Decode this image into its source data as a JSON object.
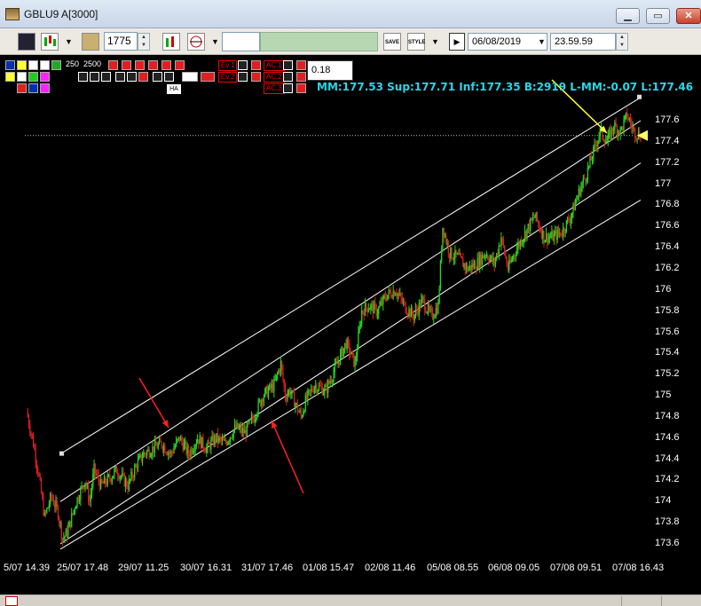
{
  "window": {
    "title": "GBLU9 A[3000]",
    "minimize_label": "▁",
    "restore_label": "▭",
    "close_label": "✕"
  },
  "toolbar": {
    "bars_value": "1775",
    "date_value": "06/08/2019",
    "time_value": "23.59.59",
    "save_tool_label": "SAVE",
    "style_tool_label": "STYLE"
  },
  "indicator_panel": {
    "row1_values": [
      "250",
      "2500"
    ],
    "ha_label": "HA",
    "param_value": "0.18",
    "buttons": [
      "Ev.1",
      "Ev.2",
      "AC.1",
      "AC.2",
      "AC.3"
    ]
  },
  "stats": {
    "text": "MM:177.53 Sup:177.71 Inf:177.35 B:2919 L-MM:-0.07 L:177.46"
  },
  "chart_data": {
    "type": "candlestick",
    "symbol": "GBLU9",
    "ylim": [
      173.45,
      177.95
    ],
    "y_ticks": [
      "177.6",
      "177.4",
      "177.2",
      "177",
      "176.8",
      "176.6",
      "176.4",
      "176.2",
      "176",
      "175.8",
      "175.6",
      "175.4",
      "175.2",
      "175",
      "174.8",
      "174.6",
      "174.4",
      "174.2",
      "174",
      "173.8",
      "173.6"
    ],
    "x_ticks": [
      "5/07 14.39",
      "25/07 17.48",
      "29/07 11.25",
      "30/07 16.31",
      "31/07 17.46",
      "01/08 15.47",
      "02/08 11.46",
      "05/08 08.55",
      "06/08 09.05",
      "07/08 09.51",
      "07/08 16.43"
    ],
    "price_path": [
      [
        0,
        174.85
      ],
      [
        3,
        174.55
      ],
      [
        5,
        174.3
      ],
      [
        8,
        173.85
      ],
      [
        11,
        174.05
      ],
      [
        14,
        173.9
      ],
      [
        16,
        173.65
      ],
      [
        18,
        173.7
      ],
      [
        22,
        174.0
      ],
      [
        26,
        174.2
      ],
      [
        28,
        174.0
      ],
      [
        30,
        174.3
      ],
      [
        33,
        174.15
      ],
      [
        36,
        174.2
      ],
      [
        40,
        174.3
      ],
      [
        45,
        174.15
      ],
      [
        49,
        174.35
      ],
      [
        52,
        174.45
      ],
      [
        56,
        174.5
      ],
      [
        60,
        174.55
      ],
      [
        64,
        174.45
      ],
      [
        68,
        174.6
      ],
      [
        72,
        174.45
      ],
      [
        76,
        174.6
      ],
      [
        80,
        174.5
      ],
      [
        84,
        174.6
      ],
      [
        88,
        174.55
      ],
      [
        93,
        174.7
      ],
      [
        97,
        174.65
      ],
      [
        101,
        174.8
      ],
      [
        105,
        175.0
      ],
      [
        110,
        175.1
      ],
      [
        113,
        175.3
      ],
      [
        115,
        175.0
      ],
      [
        117,
        175.05
      ],
      [
        120,
        174.9
      ],
      [
        122,
        174.8
      ],
      [
        124,
        174.95
      ],
      [
        128,
        175.1
      ],
      [
        133,
        175.05
      ],
      [
        138,
        175.3
      ],
      [
        142,
        175.5
      ],
      [
        146,
        175.3
      ],
      [
        149,
        175.8
      ],
      [
        152,
        175.85
      ],
      [
        156,
        175.8
      ],
      [
        160,
        175.95
      ],
      [
        164,
        176.0
      ],
      [
        168,
        175.85
      ],
      [
        172,
        175.75
      ],
      [
        176,
        175.9
      ],
      [
        180,
        175.75
      ],
      [
        183,
        175.85
      ],
      [
        185,
        176.6
      ],
      [
        188,
        176.35
      ],
      [
        192,
        176.3
      ],
      [
        196,
        176.2
      ],
      [
        200,
        176.25
      ],
      [
        204,
        176.35
      ],
      [
        208,
        176.25
      ],
      [
        211,
        176.5
      ],
      [
        214,
        176.2
      ],
      [
        218,
        176.4
      ],
      [
        222,
        176.55
      ],
      [
        226,
        176.7
      ],
      [
        230,
        176.5
      ],
      [
        234,
        176.5
      ],
      [
        238,
        176.55
      ],
      [
        242,
        176.7
      ],
      [
        246,
        176.95
      ],
      [
        249,
        177.1
      ],
      [
        252,
        177.3
      ],
      [
        255,
        177.5
      ],
      [
        258,
        177.4
      ],
      [
        261,
        177.55
      ],
      [
        264,
        177.5
      ],
      [
        267,
        177.65
      ],
      [
        270,
        177.5
      ],
      [
        273,
        177.46
      ]
    ],
    "channel_lines": [
      {
        "name": "upper",
        "from": [
          0,
          174.45
        ],
        "to": [
          100,
          177.82
        ]
      },
      {
        "name": "mid",
        "from": [
          0,
          174.0
        ],
        "to": [
          100,
          177.6
        ]
      },
      {
        "name": "lower_mid",
        "from": [
          0,
          173.6
        ],
        "to": [
          100,
          177.2
        ]
      },
      {
        "name": "lower",
        "from": [
          0,
          173.55
        ],
        "to": [
          100,
          176.85
        ]
      }
    ],
    "reference_level": 177.46,
    "up_color": "#22dd22",
    "down_color": "#e02020",
    "annotation_arrows": [
      {
        "color": "#ff2020",
        "target": "upper channel touch ~29/07"
      },
      {
        "color": "#ff2020",
        "target": "lower channel touch ~31/07"
      },
      {
        "color": "#ffff33",
        "target": "upper channel touch 07/08"
      }
    ]
  },
  "colors": {
    "background": "#000000",
    "grid_text": "#ffffff",
    "stats_text": "#29d6e8",
    "channel": "#ffffff"
  }
}
